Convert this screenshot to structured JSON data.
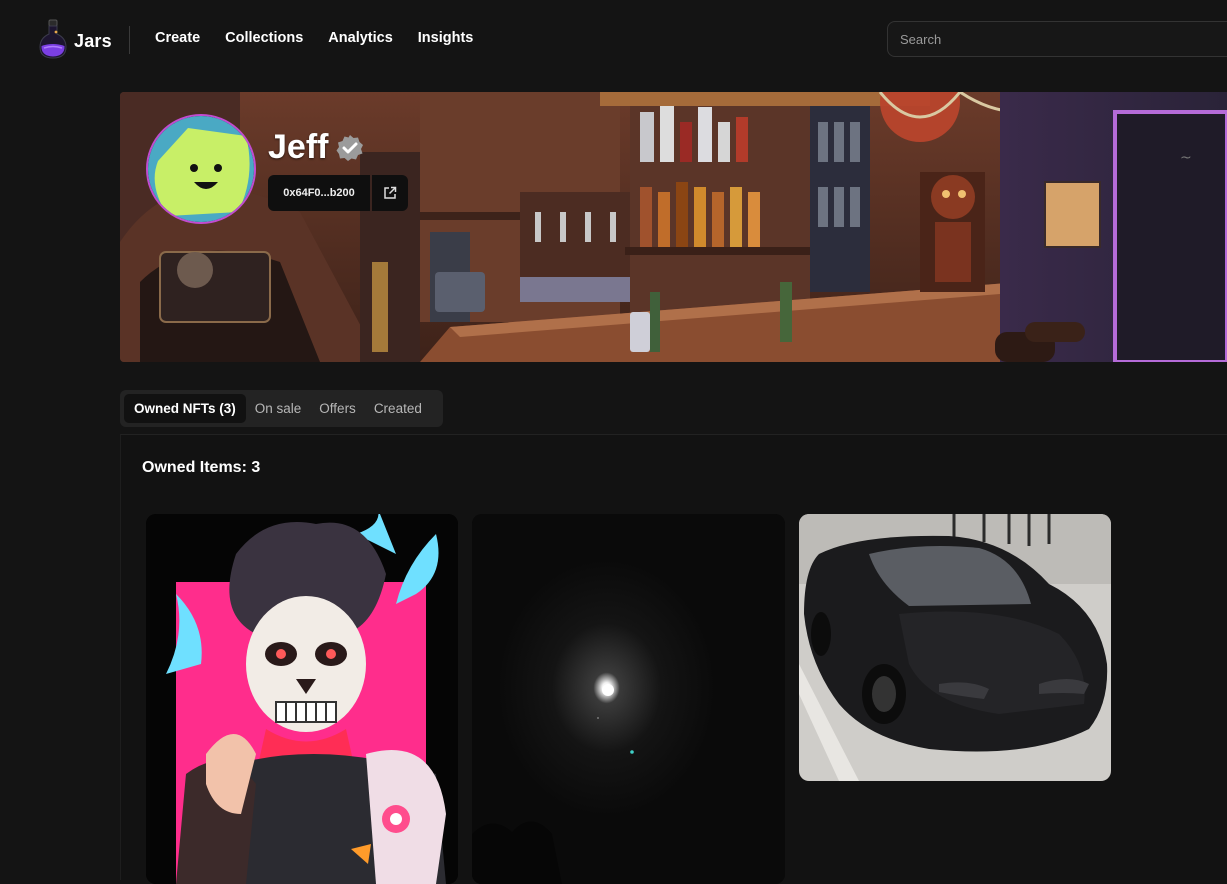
{
  "app": {
    "name": "Jars"
  },
  "nav": {
    "links": [
      "Create",
      "Collections",
      "Analytics",
      "Insights"
    ],
    "search_placeholder": "Search"
  },
  "profile": {
    "name": "Jeff",
    "address": "0x64F0...b200",
    "verified": true
  },
  "tabs": [
    {
      "label": "Owned NFTs (3)",
      "active": true
    },
    {
      "label": "On sale",
      "active": false
    },
    {
      "label": "Offers",
      "active": false
    },
    {
      "label": "Created",
      "active": false
    }
  ],
  "owned": {
    "title": "Owned Items: 3"
  },
  "colors": {
    "accent": "#c14cd0",
    "background": "#141414",
    "panel": "#232323"
  },
  "icons": [
    "jar-logo-icon",
    "verified-badge-icon",
    "external-link-icon"
  ]
}
